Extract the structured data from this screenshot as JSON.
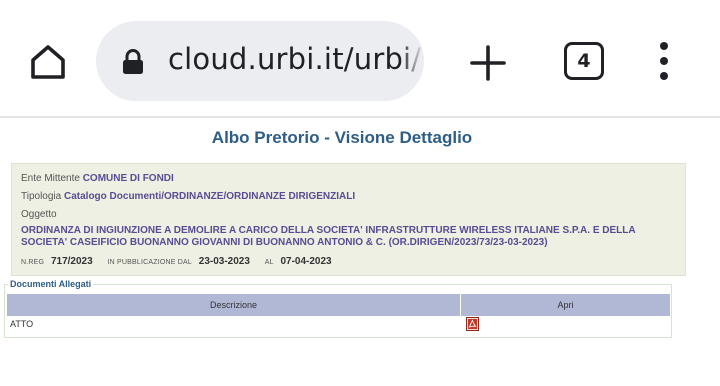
{
  "browser": {
    "url": "cloud.urbi.it/urbi/",
    "tab_count": "4",
    "icons": [
      "home-icon",
      "lock-icon",
      "plus-icon",
      "tab-switcher-icon",
      "more-vert-icon"
    ]
  },
  "page": {
    "title": "Albo Pretorio - Visione Dettaglio",
    "ente_label": "Ente Mittente",
    "ente_value": "COMUNE DI FONDI",
    "tipologia_label": "Tipologia",
    "tipologia_value": "Catalogo Documenti/ORDINANZE/ORDINANZE DIRIGENZIALI",
    "oggetto_label": "Oggetto",
    "oggetto_value": "ORDINANZA DI INGIUNZIONE A DEMOLIRE A CARICO DELLA SOCIETA' INFRASTRUTTURE WIRELESS ITALIANE S.P.A. E DELLA SOCIETA' CASEIFICIO BUONANNO GIOVANNI DI BUONANNO ANTONIO & C. (OR.DIRIGEN/2023/73/23-03-2023)",
    "nreg_label": "N.REG",
    "nreg_value": "717/2023",
    "pubblicazione_label": "IN PUBBLICAZIONE DAL",
    "pubblicazione_value": "23-03-2023",
    "al_label": "AL",
    "al_value": "07-04-2023"
  },
  "allegati": {
    "legend": "Documenti Allegati",
    "columns": [
      "Descrizione",
      "Apri"
    ],
    "rows": [
      {
        "descrizione": "ATTO",
        "icon": "pdf-icon"
      }
    ]
  },
  "colors": {
    "title": "#2e5e86",
    "value_text": "#5a4b92",
    "detail_bg": "#edf0e3",
    "table_header_bg": "#b0b8d6",
    "urlbar_bg": "#ecedf1"
  }
}
